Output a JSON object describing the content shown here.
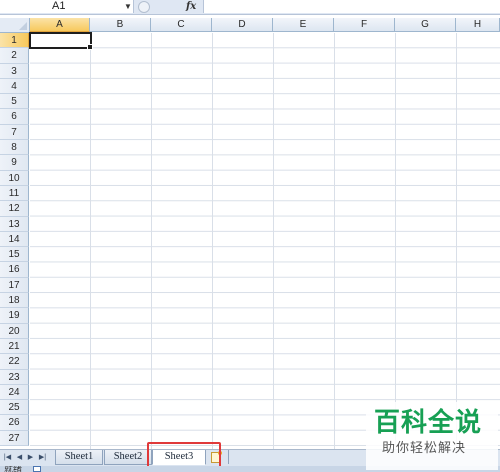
{
  "formula_bar": {
    "name_box": "A1",
    "fx_label": "fx",
    "formula_value": ""
  },
  "columns": [
    "A",
    "B",
    "C",
    "D",
    "E",
    "F",
    "G",
    "H"
  ],
  "rows": [
    "1",
    "2",
    "3",
    "4",
    "5",
    "6",
    "7",
    "8",
    "9",
    "10",
    "11",
    "12",
    "13",
    "14",
    "15",
    "16",
    "17",
    "18",
    "19",
    "20",
    "21",
    "22",
    "23",
    "24",
    "25",
    "26",
    "27"
  ],
  "active_cell": "A1",
  "sheet_tabs": [
    {
      "label": "Sheet1",
      "active": false
    },
    {
      "label": "Sheet2",
      "active": false
    },
    {
      "label": "Sheet3",
      "active": true
    }
  ],
  "status_bar": {
    "text": "就绪"
  },
  "watermark": {
    "title": "百科全说",
    "subtitle": "助你轻松解决"
  },
  "colors": {
    "active_header": "#f7c95d",
    "grid_line": "#d9dfe8",
    "highlight": "#e0393a",
    "watermark_green": "#17a054"
  }
}
